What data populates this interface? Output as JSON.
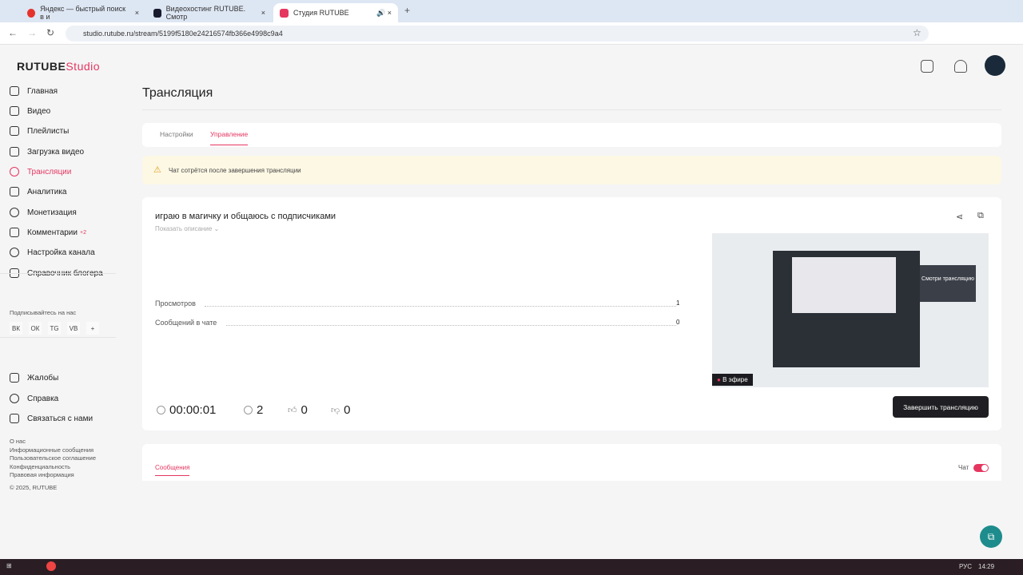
{
  "browser": {
    "tabs": [
      {
        "title": "Яндекс — быстрый поиск в и",
        "color": "#e5322d"
      },
      {
        "title": "Видеохостинг RUTUBE. Смотр",
        "color": "#1a1a2e"
      },
      {
        "title": "Студия RUTUBE",
        "color": "#e5365f"
      }
    ],
    "url": "studio.rutube.ru/stream/5199f5180e24216574fb366e4998c9a4"
  },
  "logo": {
    "brand": "RUTUBE",
    "product": "Studio"
  },
  "sidebar": {
    "items": [
      {
        "label": "Главная"
      },
      {
        "label": "Видео"
      },
      {
        "label": "Плейлисты"
      },
      {
        "label": "Загрузка видео"
      },
      {
        "label": "Трансляции"
      },
      {
        "label": "Аналитика"
      },
      {
        "label": "Монетизация"
      },
      {
        "label": "Комментарии",
        "badge": "+2"
      },
      {
        "label": "Настройка канала"
      },
      {
        "label": "Справочник блогера"
      }
    ],
    "subscribe": "Подписывайтесь на нас",
    "social": [
      "ВК",
      "ОК",
      "TG",
      "VB",
      "+"
    ],
    "bottom": [
      {
        "label": "Жалобы"
      },
      {
        "label": "Справка"
      },
      {
        "label": "Связаться с нами"
      }
    ],
    "links": [
      "О нас",
      "Информационные сообщения",
      "Пользовательское соглашение",
      "Конфиденциальность",
      "Правовая информация"
    ],
    "copyright": "© 2025, RUTUBE"
  },
  "page": {
    "title": "Трансляция",
    "tabs": [
      "Настройки",
      "Управление"
    ],
    "warning": "Чат сотрётся после завершения трансляции",
    "stream_title": "играю в магичку и общаюсь с подписчиками",
    "show_desc": "Показать описание",
    "stats": [
      {
        "label": "Просмотров",
        "value": "1"
      },
      {
        "label": "Сообщений в чате",
        "value": "0"
      }
    ],
    "timer": "00:00:01",
    "viewers": "2",
    "likes": "0",
    "dislikes": "0",
    "end_button": "Завершить трансляцию",
    "live_badge": "В эфире",
    "preview_text": "Смотри трансляцию",
    "messages_tab": "Сообщения",
    "chat_toggle": "Чат"
  },
  "taskbar": {
    "lang": "РУС",
    "time": "14:29"
  },
  "colors": {
    "accent": "#e5365f",
    "warning_bg": "#fdf8e4"
  }
}
